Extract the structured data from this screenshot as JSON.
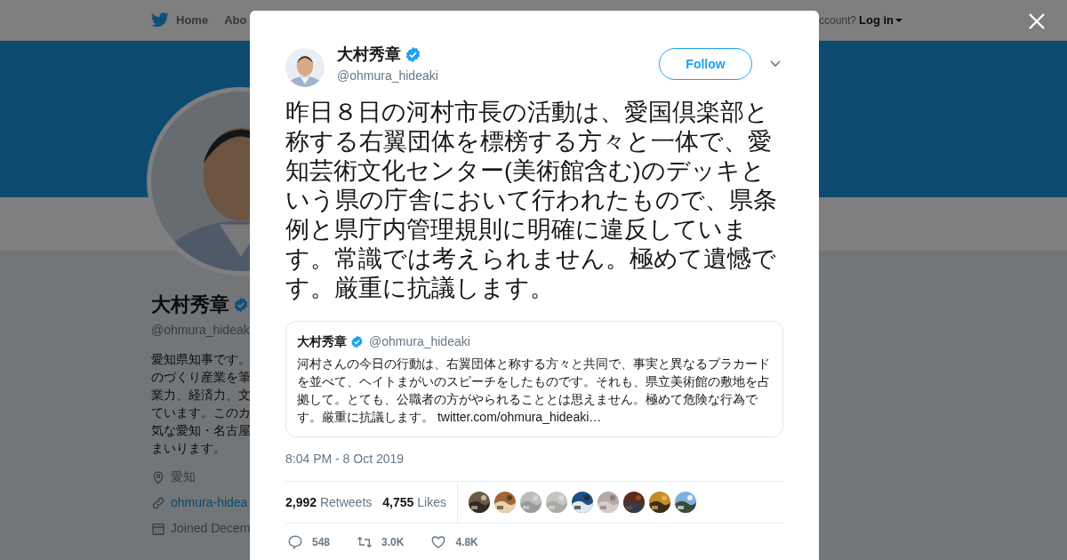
{
  "nav": {
    "items": [
      "Home",
      "Abo"
    ],
    "account_prompt": "ccount?",
    "login": "Log in"
  },
  "profile": {
    "name": "大村秀章",
    "verified": true,
    "handle": "@ohmura_hideak",
    "bio": [
      "愛知県知事です。",
      "のづくり産業を筆",
      "業力、経済力、文",
      "ています。このカ",
      "気な愛知・名古屋",
      "まいります。"
    ],
    "location": "愛知",
    "link": "ohmura-hidea",
    "joined": "Joined Decem"
  },
  "tweet": {
    "name": "大村秀章",
    "verified": true,
    "handle": "@ohmura_hideaki",
    "follow": "Follow",
    "text": "昨日８日の河村市長の活動は、愛国倶楽部と称する右翼団体を標榜する方々と一体で、愛知芸術文化センター(美術館含む)のデッキという県の庁舎において行われたもので、県条例と県庁内管理規則に明確に違反しています。常識では考えられません。極めて遺憾です。厳重に抗議します。",
    "quote": {
      "name": "大村秀章",
      "verified": true,
      "handle": "@ohmura_hideaki",
      "text": "河村さんの今日の行動は、右翼団体と称する方々と共同で、事実と異なるプラカードを並べて、ヘイトまがいのスピーチをしたものです。それも、県立美術館の敷地を占拠して。とても、公職者の方がやられることとは思えません。極めて危険な行為です。厳重に抗議します。",
      "link": "twitter.com/ohmura_hideaki…"
    },
    "timestamp": "8:04 PM - 8 Oct 2019",
    "stats": [
      {
        "count": "2,992",
        "label": "Retweets"
      },
      {
        "count": "4,755",
        "label": "Likes"
      }
    ],
    "actions": [
      {
        "kind": "reply",
        "count": "548"
      },
      {
        "kind": "retweet",
        "count": "3.0K"
      },
      {
        "kind": "like",
        "count": "4.8K"
      }
    ]
  }
}
